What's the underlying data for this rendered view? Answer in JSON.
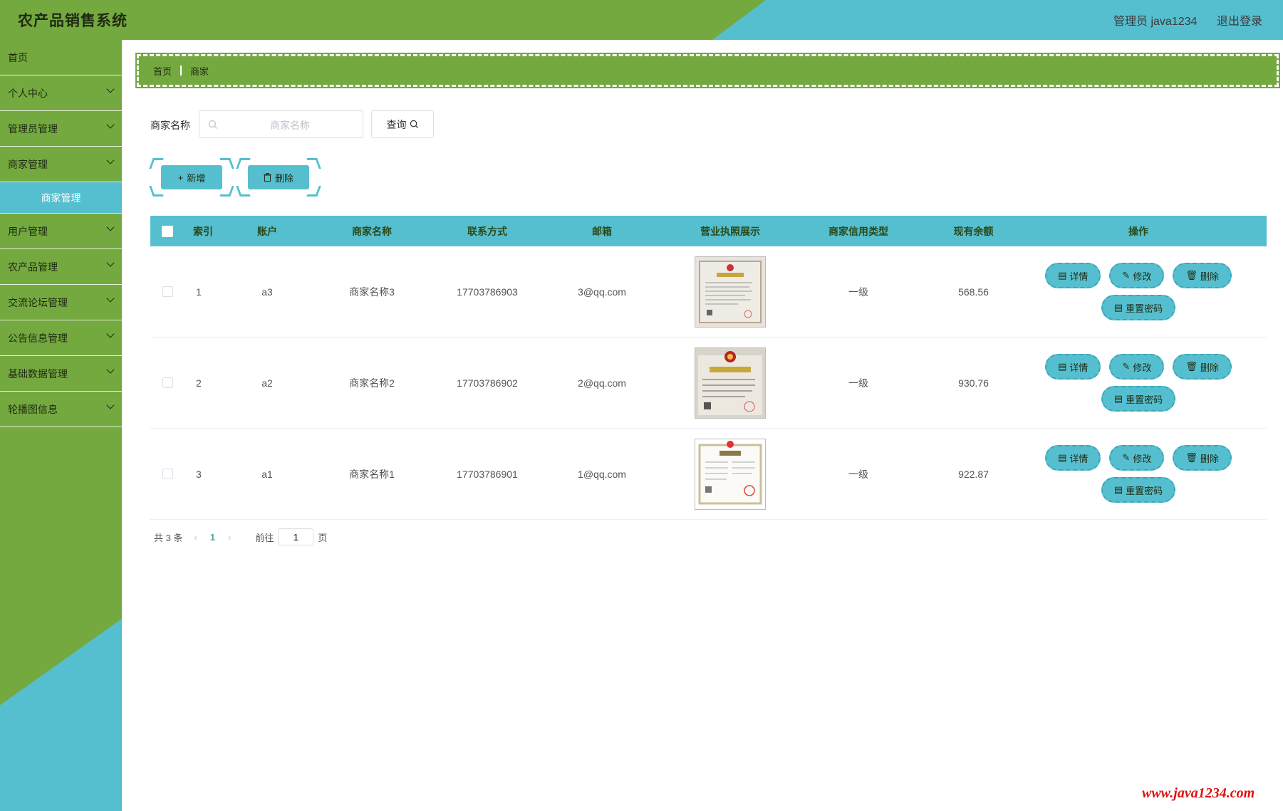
{
  "app": {
    "title": "农产品销售系统",
    "user": "管理员 java1234",
    "logout": "退出登录"
  },
  "sidebar": {
    "items": [
      {
        "label": "首页",
        "has_arrow": false
      },
      {
        "label": "个人中心",
        "has_arrow": true
      },
      {
        "label": "管理员管理",
        "has_arrow": true
      },
      {
        "label": "商家管理",
        "has_arrow": true
      },
      {
        "label": "商家管理",
        "sub": true
      },
      {
        "label": "用户管理",
        "has_arrow": true
      },
      {
        "label": "农产品管理",
        "has_arrow": true
      },
      {
        "label": "交流论坛管理",
        "has_arrow": true
      },
      {
        "label": "公告信息管理",
        "has_arrow": true
      },
      {
        "label": "基础数据管理",
        "has_arrow": true
      },
      {
        "label": "轮播图信息",
        "has_arrow": true
      }
    ]
  },
  "breadcrumb": {
    "home": "首页",
    "current": "商家"
  },
  "search": {
    "label": "商家名称",
    "placeholder": "商家名称",
    "button": "查询"
  },
  "actions": {
    "add": "新增",
    "delete": "删除"
  },
  "table": {
    "headers": [
      "索引",
      "账户",
      "商家名称",
      "联系方式",
      "邮箱",
      "营业执照展示",
      "商家信用类型",
      "现有余额",
      "操作"
    ],
    "rows": [
      {
        "index": "1",
        "account": "a3",
        "name": "商家名称3",
        "phone": "17703786903",
        "email": "3@qq.com",
        "credit": "一级",
        "balance": "568.56"
      },
      {
        "index": "2",
        "account": "a2",
        "name": "商家名称2",
        "phone": "17703786902",
        "email": "2@qq.com",
        "credit": "一级",
        "balance": "930.76"
      },
      {
        "index": "3",
        "account": "a1",
        "name": "商家名称1",
        "phone": "17703786901",
        "email": "1@qq.com",
        "credit": "一级",
        "balance": "922.87"
      }
    ],
    "ops": {
      "detail": "详情",
      "edit": "修改",
      "delete": "删除",
      "reset": "重置密码"
    }
  },
  "pagination": {
    "total": "共 3 条",
    "current": "1",
    "goto": "前往",
    "page_value": "1",
    "page_suffix": "页"
  },
  "watermark": "www.java1234.com",
  "colors": {
    "green": "#73a93f",
    "teal": "#56bfcf"
  }
}
